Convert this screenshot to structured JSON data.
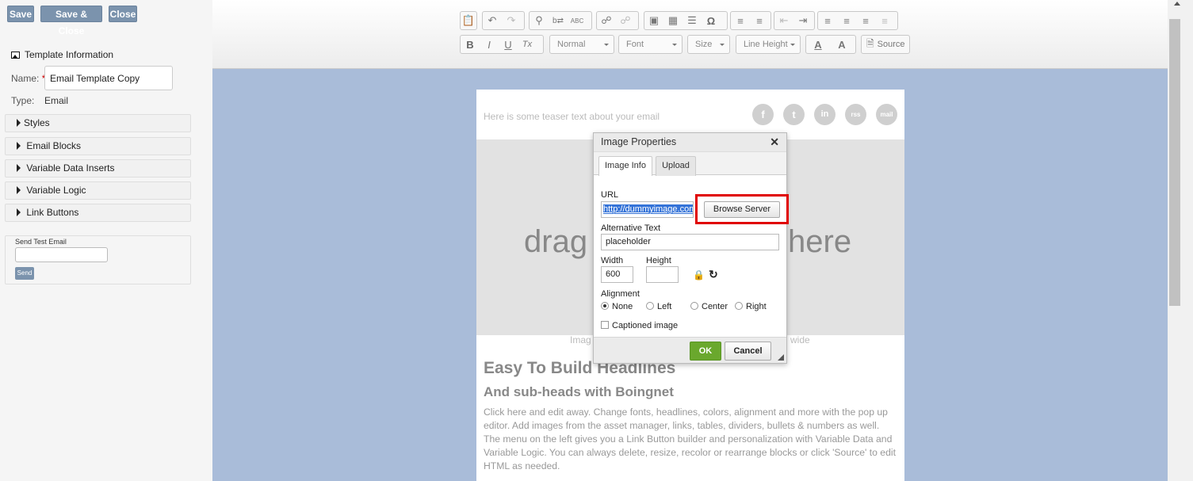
{
  "top_buttons": {
    "save": "Save",
    "save_close": "Save & Close",
    "close": "Close"
  },
  "template_info": {
    "title": "Template Information",
    "name_label": "Name:",
    "required": "*",
    "name_value": "Email Template Copy",
    "type_label": "Type:",
    "type_value": "Email"
  },
  "accordion": [
    "Styles",
    "Email Blocks",
    "Variable Data Inserts",
    "Variable Logic",
    "Link Buttons"
  ],
  "send_test": {
    "title": "Send Test Email",
    "button": "Send"
  },
  "toolbar": {
    "format": "Normal",
    "font": "Font",
    "size": "Size",
    "line_height": "Line Height",
    "text_color": "A",
    "bg_color": "A",
    "source": "Source",
    "bold": "B",
    "italic": "I",
    "underline": "U",
    "clear": "Tx"
  },
  "email": {
    "teaser": "Here is some teaser text about your email",
    "hero_left": "drag",
    "hero_right": "here",
    "caption_left": "Imag",
    "caption_right": "wide",
    "headline": "Easy To Build Headlines",
    "subhead": "And sub-heads with Boingnet",
    "body": "Click here and edit away. Change fonts, headlines, colors, alignment and more with the pop up editor. Add images from the asset manager, links, tables, dividers, bullets & numbers as well. The menu on the left gives you a Link Button builder and personalization with Variable Data and Variable Logic. You can always delete, resize, recolor or rearrange blocks or click 'Source' to edit HTML as needed.",
    "social": [
      "f",
      "t",
      "in",
      "rss",
      "mail"
    ]
  },
  "dialog": {
    "title": "Image Properties",
    "tabs": [
      "Image Info",
      "Upload"
    ],
    "url_label": "URL",
    "url_value": "http://dummyimage.com",
    "browse_button": "Browse Server",
    "alt_label": "Alternative Text",
    "alt_value": "placeholder",
    "width_label": "Width",
    "width_value": "600",
    "height_label": "Height",
    "height_value": "",
    "alignment_label": "Alignment",
    "alignment_options": [
      "None",
      "Left",
      "Center",
      "Right"
    ],
    "alignment_selected": "None",
    "captioned_label": "Captioned image",
    "ok": "OK",
    "cancel": "Cancel"
  },
  "colors": {
    "accent_button": "#7b93ad",
    "canvas": "#a9bcd9",
    "ok_green": "#6aa82d",
    "highlight": "#e00000"
  }
}
